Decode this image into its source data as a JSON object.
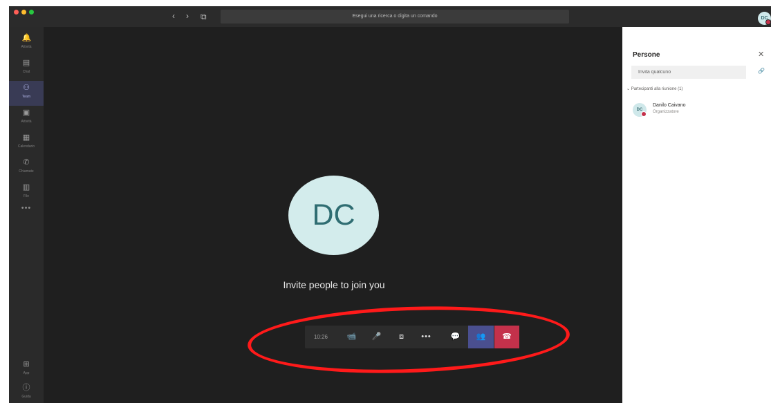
{
  "titlebar": {
    "nav_back": "‹",
    "nav_forward": "›",
    "compose": "⧉",
    "search_placeholder": "Esegui una ricerca o digita un comando",
    "user_initials": "DC"
  },
  "rail": {
    "items": [
      {
        "icon": "bell-icon",
        "glyph": "🔔",
        "label": "Attività"
      },
      {
        "icon": "chat-icon",
        "glyph": "▤",
        "label": "Chat"
      },
      {
        "icon": "teams-icon",
        "glyph": "⚇",
        "label": "Team"
      },
      {
        "icon": "briefcase-icon",
        "glyph": "▣",
        "label": "Attività"
      },
      {
        "icon": "calendar-icon",
        "glyph": "▦",
        "label": "Calendario"
      },
      {
        "icon": "phone-icon",
        "glyph": "✆",
        "label": "Chiamate"
      },
      {
        "icon": "file-icon",
        "glyph": "▥",
        "label": "File"
      }
    ],
    "more": "•••",
    "bottom": [
      {
        "icon": "apps-icon",
        "glyph": "⊞",
        "label": "App"
      },
      {
        "icon": "help-icon",
        "glyph": "ⓘ",
        "label": "Guida"
      }
    ]
  },
  "stage": {
    "avatar_initials": "DC",
    "invite_text": "Invite people to join you"
  },
  "callbar": {
    "timer": "10:26",
    "camera": "📹",
    "mic": "🎤",
    "share": "⧈",
    "more": "•••",
    "chat": "💬",
    "people": "👥",
    "hangup": "☎"
  },
  "panel": {
    "title": "Persone",
    "close": "✕",
    "invite_placeholder": "Invita qualcuno",
    "share_link": "🔗",
    "section": "Partecipanti alla riunione (1)",
    "participants": [
      {
        "initials": "DC",
        "name": "Danilo Caivano",
        "role": "Organizzatore"
      }
    ]
  },
  "colors": {
    "accent": "#4a4f8f",
    "hangup": "#c4314b",
    "annotation": "#ff1a1a"
  }
}
